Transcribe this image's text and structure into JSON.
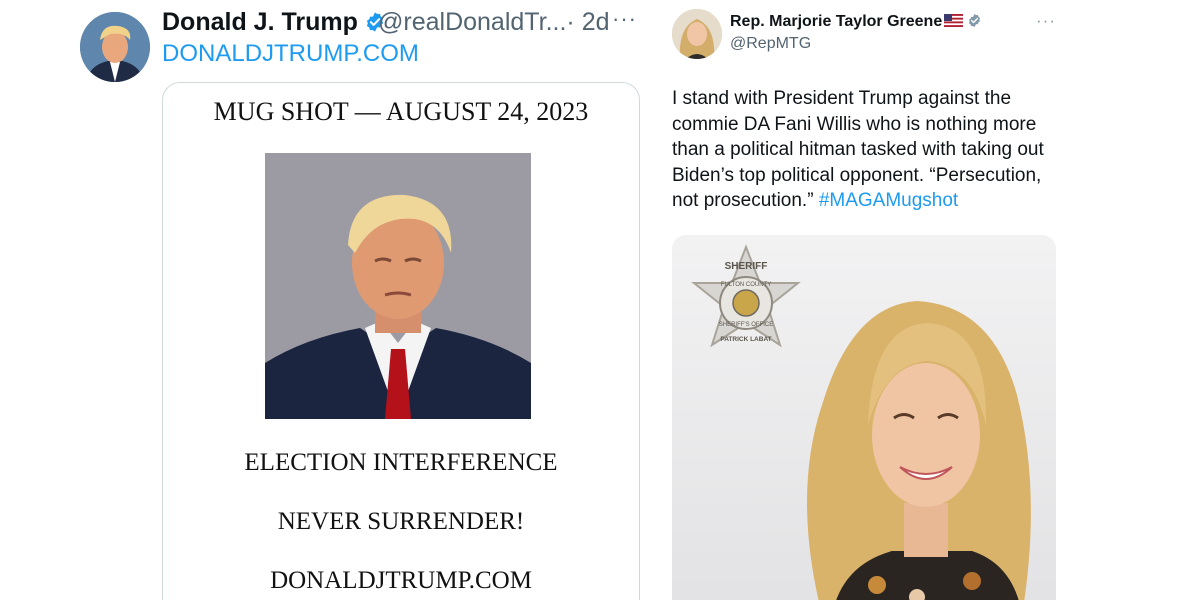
{
  "tweet_left": {
    "display_name": "Donald J. Trump",
    "handle": "@realDonaldTr...",
    "time": "· 2d",
    "more": "···",
    "profile_link": "DONALDJTRUMP.COM",
    "card": {
      "title": "MUG SHOT — AUGUST 24, 2023",
      "line1": "ELECTION INTERFERENCE",
      "line2": "NEVER SURRENDER!",
      "line3": "DONALDJTRUMP.COM"
    }
  },
  "tweet_right": {
    "display_name": "Rep. Marjorie Taylor Greene",
    "handle": "@RepMTG",
    "more": "···",
    "text": "I stand with President Trump against the commie DA Fani Willis who is nothing more than a political hitman tasked with taking out Biden’s top political opponent. “Persecution, not prosecution.” ",
    "hashtag": "#MAGAMugshot",
    "badge": {
      "top": "SHERIFF",
      "ring_top": "FULTON COUNTY",
      "ring_bottom": "SHERIFF'S OFFICE",
      "bottom": "PATRICK LABAT"
    }
  },
  "icons": {
    "verified_badge": "blue-check-icon",
    "government_badge": "gray-check-icon",
    "flag": "us-flag-icon",
    "more": "more-icon"
  },
  "colors": {
    "link": "#1d9bf0",
    "verified": "#1d9bf0",
    "secondary_text": "#536471",
    "border": "#cfd9de"
  }
}
